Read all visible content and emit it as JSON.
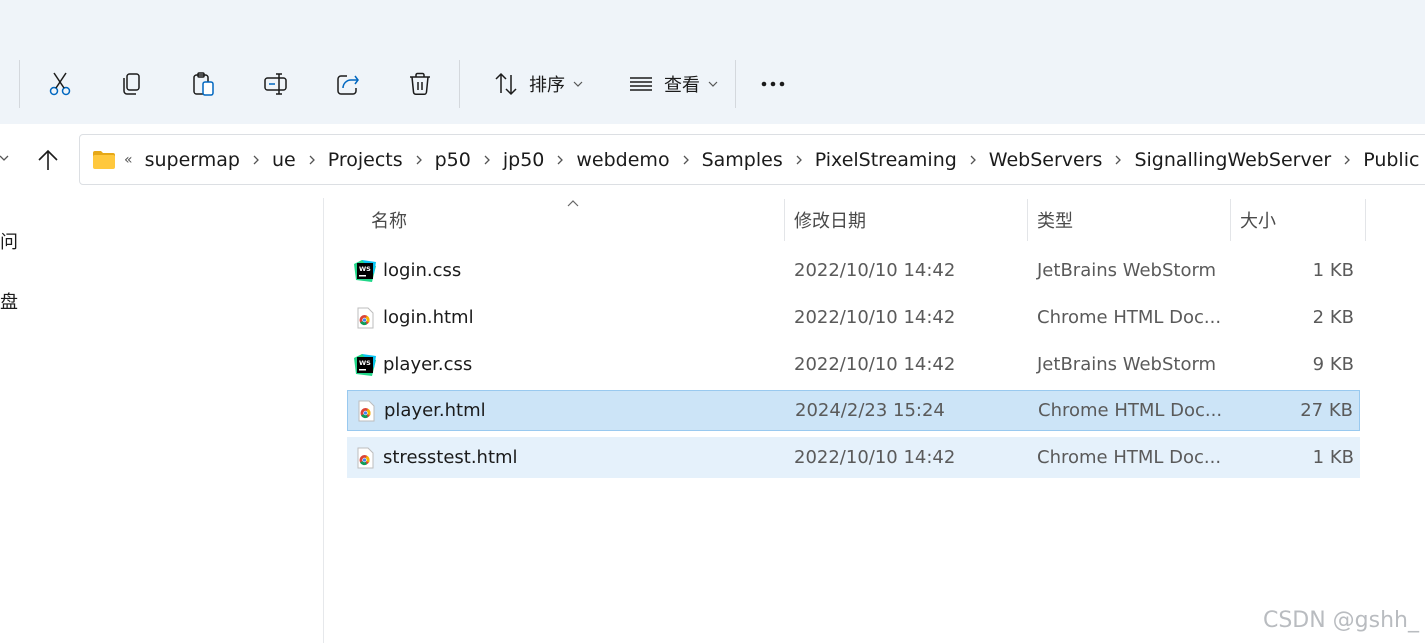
{
  "toolbar": {
    "sort_label": "排序",
    "view_label": "查看",
    "buttons": [
      "cut-icon",
      "copy-icon",
      "paste-icon",
      "rename-icon",
      "share-icon",
      "delete-icon"
    ]
  },
  "address": {
    "overflow": "«",
    "crumbs": [
      "supermap",
      "ue",
      "Projects",
      "p50",
      "jp50",
      "webdemo",
      "Samples",
      "PixelStreaming",
      "WebServers",
      "SignallingWebServer",
      "Public"
    ]
  },
  "nav": {
    "items": [
      "问",
      "盘"
    ]
  },
  "columns": {
    "name": "名称",
    "date": "修改日期",
    "type": "类型",
    "size": "大小"
  },
  "files": [
    {
      "name": "login.css",
      "date": "2022/10/10 14:42",
      "type": "JetBrains WebStorm",
      "size": "1 KB",
      "icon": "webstorm-icon",
      "state": ""
    },
    {
      "name": "login.html",
      "date": "2022/10/10 14:42",
      "type": "Chrome HTML Doc...",
      "size": "2 KB",
      "icon": "chrome-html-icon",
      "state": ""
    },
    {
      "name": "player.css",
      "date": "2022/10/10 14:42",
      "type": "JetBrains WebStorm",
      "size": "9 KB",
      "icon": "webstorm-icon",
      "state": ""
    },
    {
      "name": "player.html",
      "date": "2024/2/23 15:24",
      "type": "Chrome HTML Doc...",
      "size": "27 KB",
      "icon": "chrome-html-icon",
      "state": "selected"
    },
    {
      "name": "stresstest.html",
      "date": "2022/10/10 14:42",
      "type": "Chrome HTML Doc...",
      "size": "1 KB",
      "icon": "chrome-html-icon",
      "state": "hover"
    }
  ],
  "watermark": "CSDN @gshh_",
  "colors": {
    "selected_bg": "#cce4f7",
    "selected_border": "#99c9ef",
    "hover_bg": "#e5f1fb",
    "toolbar_bg": "#eff4f9",
    "accent": "#0067c0"
  }
}
